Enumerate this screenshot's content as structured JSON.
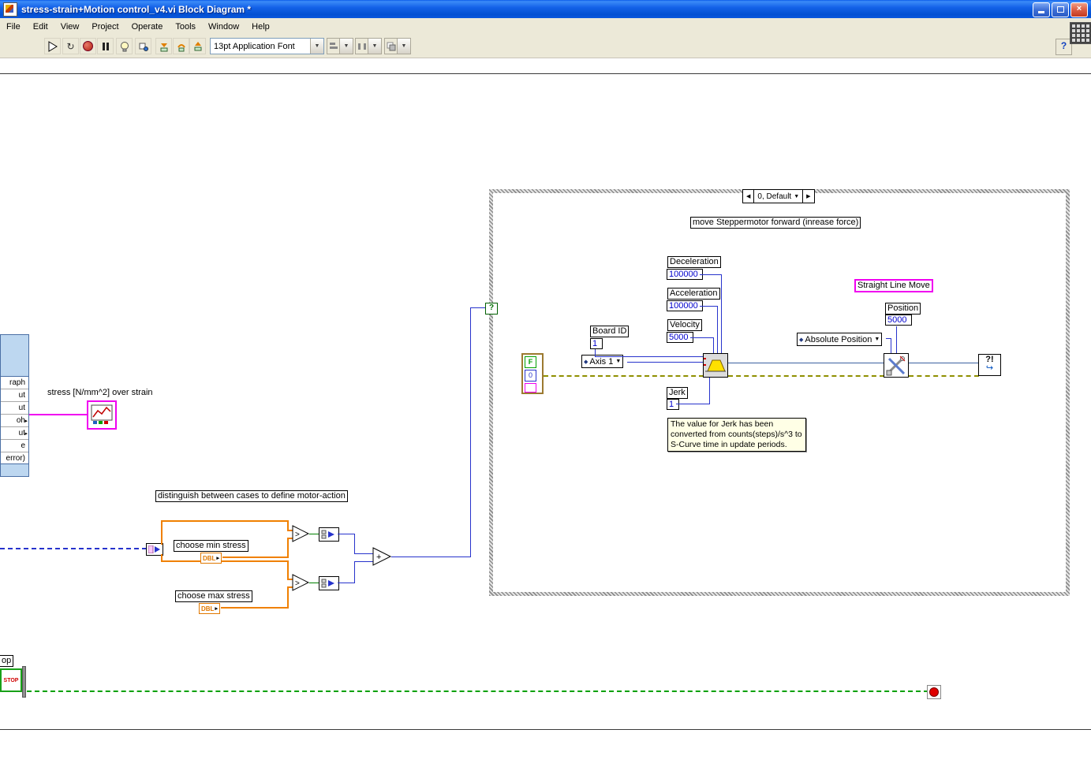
{
  "titlebar": {
    "title": "stress-strain+Motion control_v4.vi Block Diagram *"
  },
  "menu": {
    "items": [
      "File",
      "Edit",
      "View",
      "Project",
      "Operate",
      "Tools",
      "Window",
      "Help"
    ]
  },
  "toolbar": {
    "font_selector": "13pt Application Font",
    "help": "?"
  },
  "icons": {
    "dropdown": "▼",
    "case_left": "◀",
    "case_right": "▶",
    "row_arrow": "▸",
    "enum_diamond": "◆",
    "greater": ">",
    "add": "+",
    "selector_qmark": "?",
    "run_continuous": "↻",
    "error_arrow": "↪",
    "select_glyph": "▸"
  },
  "stress_node": {
    "rows": [
      "raph",
      "ut",
      "ut",
      "oh",
      "ut",
      "e",
      "error)"
    ]
  },
  "stress_graph": {
    "label": "stress [N/mm^2] over strain"
  },
  "case_structure": {
    "selector": "0, Default",
    "title_note": "move Steppermotor forward (inrease force)",
    "deceleration": {
      "label": "Deceleration",
      "value": "100000"
    },
    "acceleration": {
      "label": "Acceleration",
      "value": "100000"
    },
    "velocity": {
      "label": "Velocity",
      "value": "5000"
    },
    "board_id": {
      "label": "Board ID",
      "value": "1"
    },
    "axis": {
      "value": "Axis 1"
    },
    "jerk": {
      "label": "Jerk",
      "value": "1"
    },
    "jerk_note": "The value for Jerk has been converted from counts(steps)/s^3 to S-Curve time in update periods.",
    "straight_line_move": "Straight Line Move",
    "position": {
      "label": "Position",
      "value": "5000"
    },
    "absolute_position": {
      "value": "Absolute Position"
    },
    "cluster": {
      "bool": "F",
      "num": "0"
    },
    "error_node": "?!"
  },
  "logic": {
    "note": "distinguish between cases to define motor-action",
    "min": {
      "label": "choose min stress",
      "type": "DBL"
    },
    "max": {
      "label": "choose max stress",
      "type": "DBL"
    }
  },
  "loop": {
    "stop_label": "op",
    "stop_button": "STOP"
  }
}
